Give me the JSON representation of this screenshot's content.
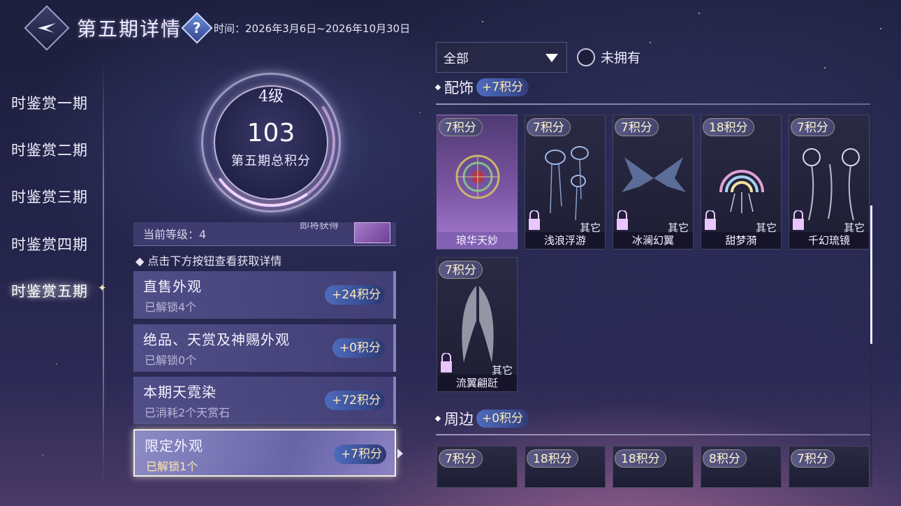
{
  "header": {
    "title": "第五期详情",
    "time": "时间：2026年3月6日~2026年10月30日"
  },
  "nav": {
    "items": [
      {
        "label": "时鉴赏一期"
      },
      {
        "label": "时鉴赏二期"
      },
      {
        "label": "时鉴赏三期"
      },
      {
        "label": "时鉴赏四期"
      },
      {
        "label": "时鉴赏五期"
      }
    ],
    "active_index": 4
  },
  "score": {
    "level": "4级",
    "total": "103",
    "caption": "第五期总积分"
  },
  "level_strip": {
    "current": "当前等级：4",
    "reward_text": "即将获得"
  },
  "hint": "点击下方按钮查看获取详情",
  "categories": [
    {
      "title": "直售外观",
      "sub": "已解锁4个",
      "points": "+24积分"
    },
    {
      "title": "绝品、天赏及神赐外观",
      "sub": "已解锁0个",
      "points": "+0积分"
    },
    {
      "title": "本期天霓染",
      "sub": "已消耗2个天赏石",
      "points": "+72积分"
    },
    {
      "title": "限定外观",
      "sub": "已解锁1个",
      "points": "+7积分"
    }
  ],
  "filter": {
    "selected": "全部",
    "owned_label": "未拥有"
  },
  "sections": [
    {
      "name": "配饰",
      "points": "+7积分",
      "items": [
        {
          "badge": "7积分",
          "name": "琅华天妙",
          "kind": ""
        },
        {
          "badge": "7积分",
          "name": "浅浪浮游",
          "kind": "其它"
        },
        {
          "badge": "7积分",
          "name": "冰澜幻翼",
          "kind": "其它"
        },
        {
          "badge": "18积分",
          "name": "甜梦漪",
          "kind": "其它"
        },
        {
          "badge": "7积分",
          "name": "千幻琉镜",
          "kind": "其它"
        },
        {
          "badge": "7积分",
          "name": "流翼翩跹",
          "kind": "其它"
        }
      ]
    },
    {
      "name": "周边",
      "points": "+0积分",
      "items": [
        {
          "badge": "7积分"
        },
        {
          "badge": "18积分"
        },
        {
          "badge": "18积分"
        },
        {
          "badge": "8积分"
        },
        {
          "badge": "7积分"
        }
      ]
    }
  ]
}
